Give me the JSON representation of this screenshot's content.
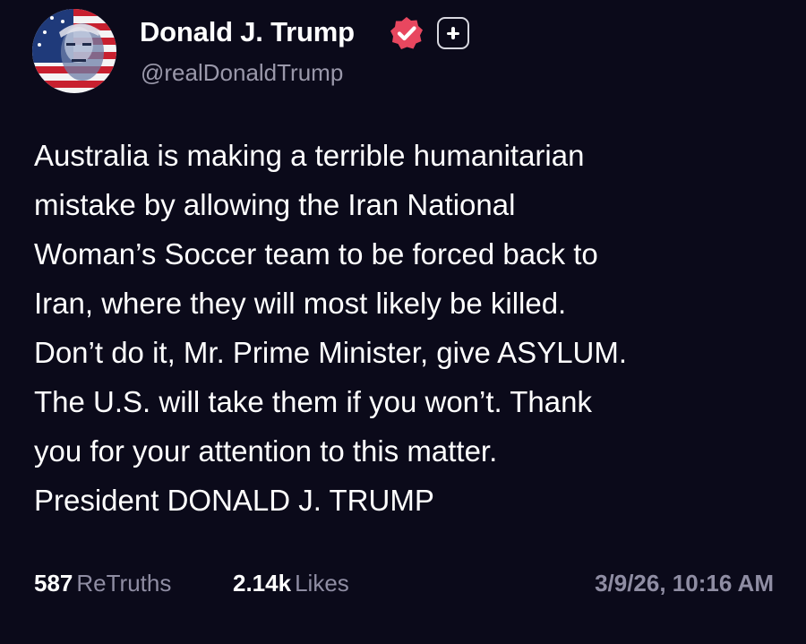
{
  "author": {
    "display_name": "Donald J. Trump",
    "handle": "@realDonaldTrump",
    "avatar_icon": "flag-portrait-avatar",
    "verified_icon": "verified-badge-icon",
    "badge_icon": "plus-badge-icon"
  },
  "post": {
    "text": "Australia is making a terrible humanitarian\nmistake by allowing the Iran National\nWoman’s Soccer team to be forced back to\nIran, where they will most likely be killed.\nDon’t do it, Mr. Prime Minister, give ASYLUM.\nThe U.S. will take them if you won’t. Thank\nyou for your attention to this matter.\nPresident DONALD J. TRUMP"
  },
  "stats": {
    "retruths_count": "587",
    "retruths_label": "ReTruths",
    "likes_count": "2.14k",
    "likes_label": "Likes",
    "timestamp": "3/9/26, 10:16 AM"
  },
  "colors": {
    "background": "#0b0a1a",
    "text": "#ffffff",
    "muted": "#8f8da3",
    "verified": "#e8475f"
  }
}
